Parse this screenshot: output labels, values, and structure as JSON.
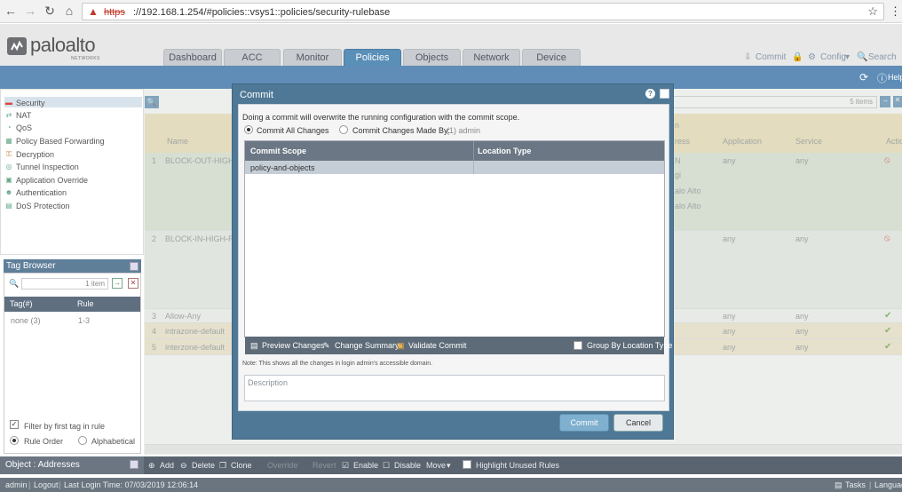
{
  "browser": {
    "url_scheme": "https",
    "url_rest": "://192.168.1.254/#policies::vsys1::policies/security-rulebase"
  },
  "logo": {
    "name": "paloalto",
    "sub": "NETWORKS"
  },
  "tabs": [
    "Dashboard",
    "ACC",
    "Monitor",
    "Policies",
    "Objects",
    "Network",
    "Device"
  ],
  "header_actions": {
    "commit": "Commit",
    "config": "Config",
    "search": "Search",
    "help": "Help"
  },
  "nav": {
    "items": [
      "Security",
      "NAT",
      "QoS",
      "Policy Based Forwarding",
      "Decryption",
      "Tunnel Inspection",
      "Application Override",
      "Authentication",
      "DoS Protection"
    ]
  },
  "tag_browser": {
    "title": "Tag Browser",
    "count": "1 item",
    "col_tag": "Tag(#)",
    "col_rule": "Rule",
    "row_tag": "none (3)",
    "row_rule": "1-3",
    "filter_label": "Filter by first tag in rule",
    "rule_order": "Rule Order",
    "alphabetical": "Alphabetical",
    "object_label": "Object : Addresses"
  },
  "grid": {
    "items_count": "5 items",
    "col_name": "Name",
    "col_application": "Application",
    "col_service": "Service",
    "col_action": "Actio",
    "col_address": "ress",
    "header_group": "n",
    "rows": [
      {
        "num": "1",
        "name": "BLOCK-OUT-HIGH-I",
        "app": "any",
        "service": "any",
        "extra1": "N",
        "extra2": "gi",
        "extra3": "alo Alto",
        "extra4": "alo Alto"
      },
      {
        "num": "2",
        "name": "BLOCK-IN-HIGH-R",
        "app": "any",
        "service": "any"
      },
      {
        "num": "3",
        "name": "Allow-Any",
        "app": "any",
        "service": "any"
      },
      {
        "num": "4",
        "name": "intrazone-default",
        "app": "any",
        "service": "any"
      },
      {
        "num": "5",
        "name": "interzone-default",
        "app": "any",
        "service": "any"
      }
    ]
  },
  "bottom_toolbar": {
    "add": "Add",
    "delete": "Delete",
    "clone": "Clone",
    "override": "Override",
    "revert": "Revert",
    "enable": "Enable",
    "disable": "Disable",
    "move": "Move",
    "highlight": "Highlight Unused Rules"
  },
  "status_bar": {
    "user": "admin",
    "logout": "Logout",
    "last_login": "Last Login Time: 07/03/2019 12:06:14",
    "tasks": "Tasks",
    "language": "Languag"
  },
  "modal": {
    "title": "Commit",
    "message": "Doing a commit will overwrite the running configuration with the commit scope.",
    "option_all": "Commit All Changes",
    "option_by": "Commit Changes Made By:",
    "option_by_value": "(1) admin",
    "col_scope": "Commit Scope",
    "col_location": "Location Type",
    "scope_row": "policy-and-objects",
    "preview": "Preview Changes",
    "summary": "Change Summary",
    "validate": "Validate Commit",
    "group_by": "Group By Location Type",
    "note": "Note: This shows all the changes in login admin's accessible domain.",
    "description_placeholder": "Description",
    "commit_button": "Commit",
    "cancel_button": "Cancel"
  },
  "colors": {
    "accent": "#5f8db7",
    "modal": "#4e7895",
    "toolbar": "#5a6470"
  }
}
